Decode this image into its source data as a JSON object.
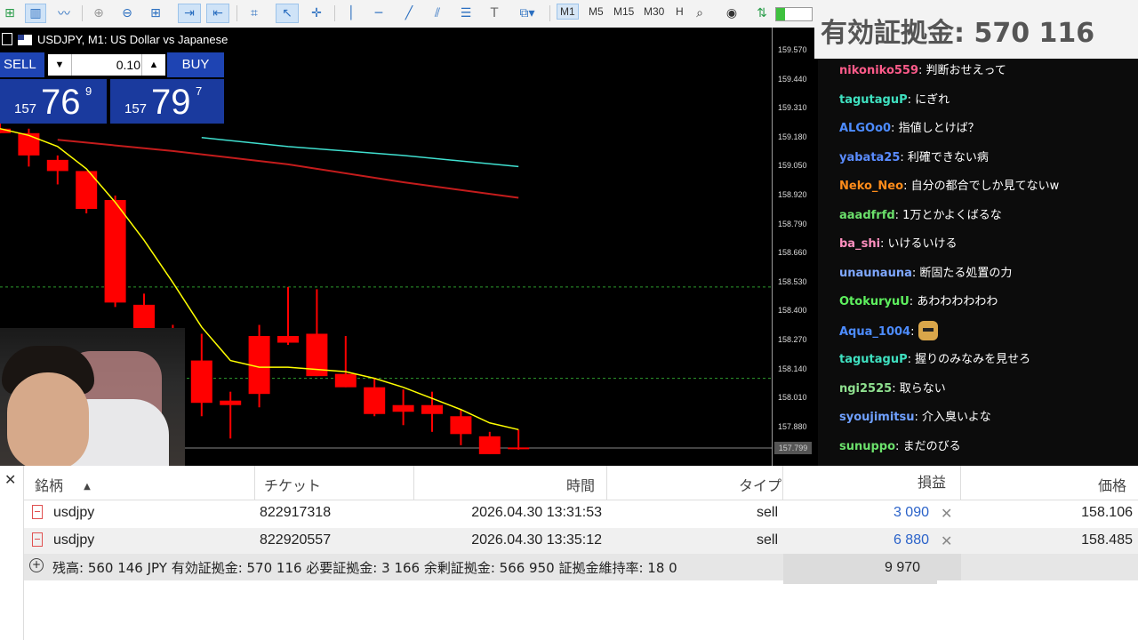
{
  "toolbar": {
    "timeframes": [
      "M1",
      "M5",
      "M15",
      "M30",
      "H"
    ],
    "active_timeframe": "M1",
    "icons": [
      "new-chart-icon",
      "bar-chart-icon",
      "line-chart-icon",
      "zoom-in-icon",
      "zoom-out-icon",
      "grid-icon",
      "autoscroll-icon",
      "chart-shift-icon",
      "screenshot-icon",
      "cursor-icon",
      "crosshair-icon",
      "vertical-line-icon",
      "horizontal-line-icon",
      "trend-line-icon",
      "channel-icon",
      "fibonacci-icon",
      "text-icon",
      "shapes-icon",
      "search-icon",
      "account-icon",
      "signal-icon"
    ]
  },
  "equity_overlay": {
    "text": "有効証拠金: 570 116"
  },
  "chart": {
    "title": "USDJPY, M1:  US Dollar vs Japanese",
    "trade_panel": {
      "sell_label": "SELL",
      "buy_label": "BUY",
      "lot": "0.10",
      "bid": {
        "small": "157",
        "big": "76",
        "pip": "9"
      },
      "ask": {
        "small": "157",
        "big": "79",
        "pip": "7"
      }
    },
    "price_ticks": [
      "159.570",
      "159.440",
      "159.310",
      "159.180",
      "159.050",
      "158.920",
      "158.790",
      "158.660",
      "158.530",
      "158.400",
      "158.270",
      "158.140",
      "158.010",
      "157.880"
    ],
    "current_price": "157.799",
    "colors": {
      "bull": "#ff0000",
      "ma_fast": "#ffff00",
      "ma_mid": "#ff0000",
      "ma_slow": "#40e0d0",
      "level": "#2e9c2e"
    }
  },
  "chart_data": {
    "type": "candlestick",
    "ylim": [
      157.75,
      159.63
    ],
    "candles": [
      {
        "o": 159.22,
        "h": 159.25,
        "l": 159.2,
        "c": 159.2
      },
      {
        "o": 159.2,
        "h": 159.22,
        "l": 159.05,
        "c": 159.1
      },
      {
        "o": 159.08,
        "h": 159.1,
        "l": 158.97,
        "c": 159.03
      },
      {
        "o": 159.03,
        "h": 159.03,
        "l": 158.84,
        "c": 158.86
      },
      {
        "o": 158.9,
        "h": 158.92,
        "l": 158.42,
        "c": 158.44
      },
      {
        "o": 158.43,
        "h": 158.48,
        "l": 158.27,
        "c": 158.32
      },
      {
        "o": 158.32,
        "h": 158.34,
        "l": 158.15,
        "c": 158.2
      },
      {
        "o": 158.18,
        "h": 158.3,
        "l": 157.93,
        "c": 157.99
      },
      {
        "o": 158.0,
        "h": 158.04,
        "l": 157.83,
        "c": 157.98
      },
      {
        "o": 158.29,
        "h": 158.34,
        "l": 157.97,
        "c": 158.03
      },
      {
        "o": 158.29,
        "h": 158.51,
        "l": 158.25,
        "c": 158.26
      },
      {
        "o": 158.3,
        "h": 158.5,
        "l": 158.11,
        "c": 158.11
      },
      {
        "o": 158.12,
        "h": 158.29,
        "l": 158.06,
        "c": 158.06
      },
      {
        "o": 158.06,
        "h": 158.1,
        "l": 157.93,
        "c": 157.94
      },
      {
        "o": 157.98,
        "h": 158.05,
        "l": 157.89,
        "c": 157.95
      },
      {
        "o": 157.98,
        "h": 158.04,
        "l": 157.86,
        "c": 157.94
      },
      {
        "o": 157.93,
        "h": 157.96,
        "l": 157.8,
        "c": 157.85
      },
      {
        "o": 157.84,
        "h": 157.86,
        "l": 157.76,
        "c": 157.76
      },
      {
        "o": 157.79,
        "h": 157.87,
        "l": 157.78,
        "c": 157.79
      }
    ],
    "ma_fast": [
      159.22,
      159.19,
      159.14,
      159.04,
      158.89,
      158.72,
      158.53,
      158.33,
      158.18,
      158.15,
      158.15,
      158.14,
      158.13,
      158.1,
      158.06,
      158.01,
      157.96,
      157.9,
      157.87
    ],
    "ma_mid": [
      [
        2,
        159.17
      ],
      [
        6,
        159.12
      ],
      [
        10,
        159.06
      ],
      [
        14,
        158.98
      ],
      [
        18,
        158.91
      ]
    ],
    "ma_slow": [
      [
        7,
        159.18
      ],
      [
        10,
        159.14
      ],
      [
        14,
        159.1
      ],
      [
        18,
        159.05
      ]
    ],
    "levels": [
      158.51,
      158.1
    ]
  },
  "chat": [
    {
      "user": "nikoniko559",
      "color": "#ff5b8a",
      "text": "判断おせえって"
    },
    {
      "user": "tagutaguP",
      "color": "#3fe0c0",
      "text": "にぎれ"
    },
    {
      "user": "ALGOo0",
      "color": "#4d8cff",
      "text": "指値しとけば？"
    },
    {
      "user": "yabata25",
      "color": "#5a8cff",
      "text": "利確できない病"
    },
    {
      "user": "Neko_Neo",
      "color": "#ff8c1a",
      "text": "自分の都合でしか見てないw"
    },
    {
      "user": "aaadfrfd",
      "color": "#6be06b",
      "text": "1万とかよくばるな"
    },
    {
      "user": "ba_shi",
      "color": "#ff8fbf",
      "text": "いけるいける"
    },
    {
      "user": "unaunauna",
      "color": "#7fa8ff",
      "text": "断固たる処置の力"
    },
    {
      "user": "OtokuryuU",
      "color": "#5ef05e",
      "text": "あわわわわわわ"
    },
    {
      "user": "Aqua_1004",
      "color": "#4d8cff",
      "text": ""
    },
    {
      "user": "tagutaguP",
      "color": "#3fe0c0",
      "text": "握りのみなみを見せろ"
    },
    {
      "user": "ngi2525",
      "color": "#8fe08f",
      "text": "取らない"
    },
    {
      "user": "syoujimitsu",
      "color": "#6fa0ff",
      "text": "介入臭いよな"
    },
    {
      "user": "sunuppo",
      "color": "#6be06b",
      "text": "まだのびる"
    }
  ],
  "positions": {
    "headers": {
      "symbol": "銘柄",
      "ticket": "チケット",
      "time": "時間",
      "type": "タイプ",
      "profit": "損益",
      "price": "価格"
    },
    "rows": [
      {
        "symbol": "usdjpy",
        "ticket": "822917318",
        "time": "2026.04.30 13:31:53",
        "type": "sell",
        "profit": "3 090",
        "price": "158.106"
      },
      {
        "symbol": "usdjpy",
        "ticket": "822920557",
        "time": "2026.04.30 13:35:12",
        "type": "sell",
        "profit": "6 880",
        "price": "158.485"
      }
    ],
    "summary": "残高: 560 146 JPY  有効証拠金: 570 116  必要証拠金: 3 166  余剰証拠金: 566 950  証拠金維持率: 18 0",
    "total_profit": "9 970",
    "close_glyph": "✕",
    "remove_glyph": "✕",
    "expand_glyph": "+",
    "sort_glyph": "▲"
  }
}
